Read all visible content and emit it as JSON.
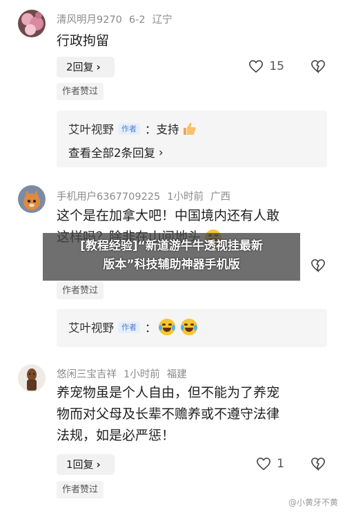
{
  "comments": [
    {
      "user": "清风明月9270",
      "time": "6-2",
      "location": "辽宁",
      "text": "行政拘留",
      "reply_pill": "2回复",
      "likes": "15",
      "author_liked": "作者赞过",
      "replies": [
        {
          "name": "艾叶视野",
          "tag": "作者",
          "text": "：支持"
        }
      ],
      "view_all": "查看全部2条回复",
      "avatar_icon": "blossom-avatar"
    },
    {
      "user": "手机用户6367709225",
      "time": "1小时前",
      "location": "广西",
      "text_line1": "这个是在加拿大吧！中国境内还有人敢",
      "text_line2": "这样吗？除非在山间地头",
      "author_liked": "作者赞过",
      "replies": [
        {
          "name": "艾叶视野",
          "tag": "作者",
          "text": "："
        }
      ],
      "avatar_icon": "cartoon-avatar"
    },
    {
      "user": "悠闲三宝吉祥",
      "time": "1小时前",
      "location": "福建",
      "text_line1": "养宠物虽是个人自由，但不能为了养宠",
      "text_line2": "物而对父母及长辈不赡养或不遵守法律",
      "text_line3": "法规，如是必严惩！",
      "reply_pill": "1回复",
      "likes": "1",
      "author_liked": "作者赞过",
      "avatar_icon": "statue-avatar"
    }
  ],
  "overlay": {
    "line1": "[教程经验]“新道游牛牛透视挂最新",
    "line2": "版本”科技辅助神器手机版"
  },
  "watermark": "@小黄牙不黄",
  "colors": {
    "author_tag": "#4a7fd6",
    "muted": "#8a8a8a",
    "reply_bg": "#f5f5f5"
  }
}
